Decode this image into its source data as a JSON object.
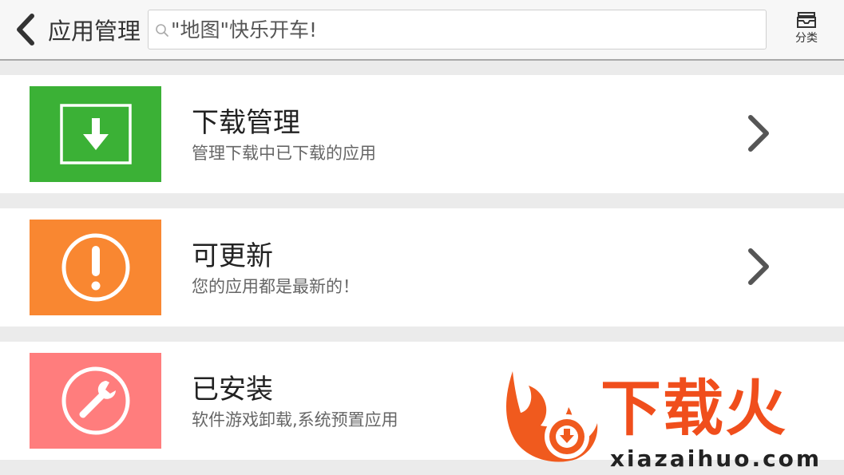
{
  "header": {
    "title": "应用管理",
    "search_placeholder": "\"地图\"快乐开车!",
    "category_label": "分类"
  },
  "items": [
    {
      "title": "下载管理",
      "subtitle": "管理下载中已下载的应用",
      "icon": "download-icon",
      "color": "#3bb136"
    },
    {
      "title": "可更新",
      "subtitle": "您的应用都是最新的！",
      "icon": "exclamation-icon",
      "color": "#f98731"
    },
    {
      "title": "已安装",
      "subtitle": "软件游戏卸载,系统预置应用",
      "icon": "wrench-icon",
      "color": "#ff7d7d"
    }
  ],
  "watermark": {
    "brand": "下载火",
    "url": "xiazaihuo.com"
  }
}
